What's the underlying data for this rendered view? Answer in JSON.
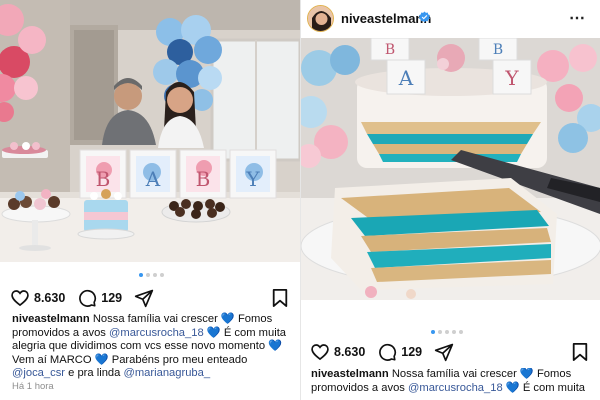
{
  "left_post": {
    "photo_blocks": [
      "B",
      "A",
      "B",
      "Y"
    ],
    "carousel": {
      "count": 4,
      "active": 0
    },
    "likes": "8.630",
    "comments": "129",
    "caption": {
      "username": "niveastelmann",
      "part1": " Nossa família vai crescer ",
      "part2": " Fomos promovidos a avos ",
      "mention1": "@marcusrocha_18",
      "part3": " É com muita alegria que dividimos com vcs esse novo momento ",
      "part4": " Vem aí MARCO ",
      "part5": " Parabéns pro meu enteado ",
      "mention2": "@joca_csr",
      "part6": " e pra linda ",
      "mention3": "@marianagruba_"
    },
    "timestamp": "Há 1 hora"
  },
  "right_post": {
    "username": "niveastelmann",
    "photo_blocks": [
      "B",
      "A",
      "B",
      "Y"
    ],
    "carousel": {
      "count": 5,
      "active": 0
    },
    "likes": "8.630",
    "comments": "129",
    "caption": {
      "username": "niveastelmann",
      "part1": " Nossa família vai crescer ",
      "part2": " Fomos promovidos a avos ",
      "mention1": "@marcusrocha_18",
      "part3": " É com muita"
    }
  },
  "colors": {
    "heart_emoji": "#2b8cf0",
    "mention": "#385898",
    "carousel_active": "#3897f0",
    "verified_badge": "#3897f0",
    "cake_filling": "#1fa9b8"
  },
  "icons": [
    "heart-icon",
    "comment-icon",
    "share-icon",
    "bookmark-icon",
    "verified-badge-icon",
    "more-options-icon",
    "blue-heart-emoji"
  ]
}
